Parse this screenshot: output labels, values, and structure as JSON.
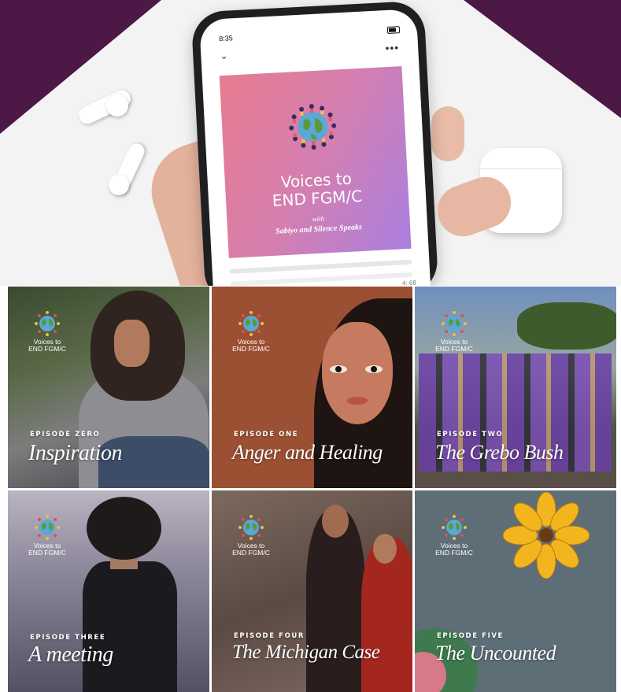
{
  "hero": {
    "status_time": "8:35",
    "menu_glyph": "•••",
    "back_glyph": "⌄",
    "time_remaining": "4: 68",
    "artwork": {
      "title_line1": "Voices to",
      "title_line2": "END FGM/C",
      "with": "with",
      "subtitle": "Sabiyo and Silence Speaks"
    }
  },
  "logo": {
    "line1": "Voices to",
    "line2": "END FGM/C"
  },
  "episodes": [
    {
      "label": "EPISODE ZERO",
      "title": "Inspiration"
    },
    {
      "label": "EPISODE ONE",
      "title": "Anger and Healing"
    },
    {
      "label": "EPISODE TWO",
      "title": "The Grebo Bush"
    },
    {
      "label": "EPISODE THREE",
      "title": "A meeting"
    },
    {
      "label": "EPISODE FOUR",
      "title": "The Michigan Case"
    },
    {
      "label": "EPISODE FIVE",
      "title": "The Uncounted"
    }
  ],
  "colors": {
    "brand_purple": "#4d1846",
    "artwork_gradient_start": "#e77b8f",
    "artwork_gradient_end": "#a97fe0"
  },
  "icons": [
    "globe-logo-icon",
    "chevron-down-icon",
    "more-icon",
    "battery-icon"
  ]
}
